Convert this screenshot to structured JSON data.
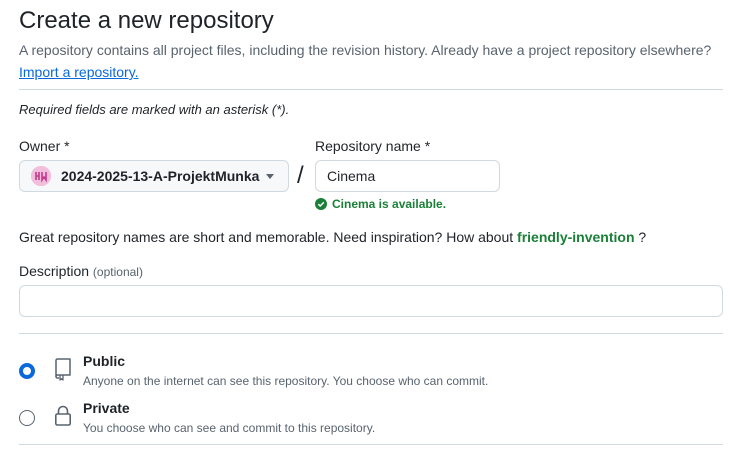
{
  "header": {
    "title": "Create a new repository",
    "subtitle": "A repository contains all project files, including the revision history. Already have a project repository elsewhere?",
    "import_link": "Import a repository."
  },
  "required_note": "Required fields are marked with an asterisk (*).",
  "owner": {
    "label": "Owner *",
    "value": "2024-2025-13-A-ProjektMunka",
    "avatar_color": "#e8a3ce"
  },
  "separator": "/",
  "repository": {
    "label": "Repository name *",
    "value": "Cinema",
    "availability": "Cinema is available.",
    "availability_color": "#1a7f37"
  },
  "inspiration": {
    "text": "Great repository names are short and memorable. Need inspiration? How about",
    "suggestion": "friendly-invention",
    "suffix": "?"
  },
  "description": {
    "label": "Description",
    "optional": "(optional)",
    "value": ""
  },
  "visibility": {
    "selected": "public",
    "options": [
      {
        "title": "Public",
        "description": "Anyone on the internet can see this repository. You choose who can commit.",
        "icon": "repo-icon"
      },
      {
        "title": "Private",
        "description": "You choose who can see and commit to this repository.",
        "icon": "lock-icon"
      }
    ]
  },
  "colors": {
    "accent": "#0969da",
    "success": "#1a7f37",
    "muted": "#59636e",
    "border": "#d1d9e0"
  }
}
